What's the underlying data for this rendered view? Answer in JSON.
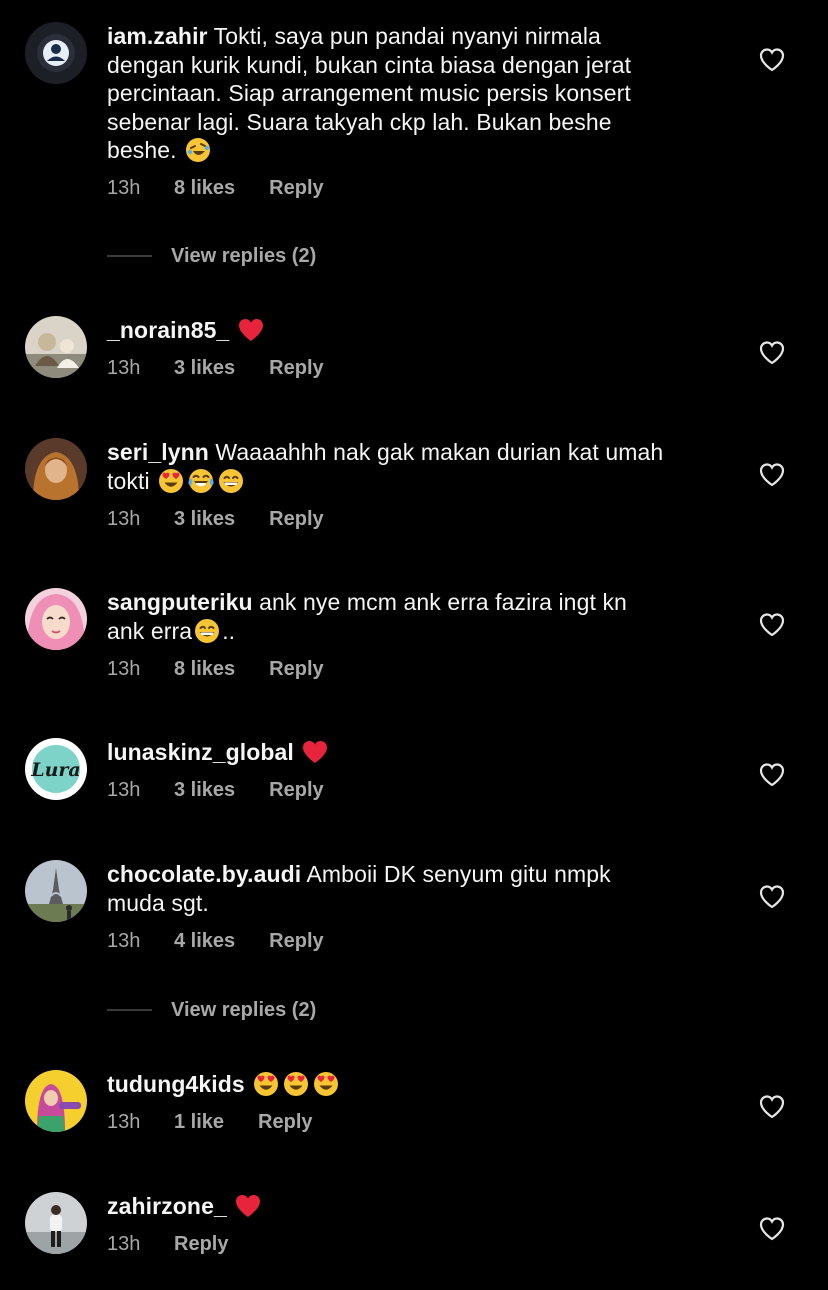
{
  "comments": [
    {
      "username": "iam.zahir",
      "text": " Tokti, saya pun pandai nyanyi nirmala\ndengan kurik kundi, bukan cinta biasa dengan jerat\npercintaan. Siap arrangement music persis konsert\nsebenar lagi. Suara takyah ckp lah. Bukan beshe\nbeshe. ",
      "emojis": [
        "rolling-on-floor-laughing"
      ],
      "time": "13h",
      "likes": "8 likes",
      "reply": "Reply",
      "view_replies": "View replies (2)"
    },
    {
      "username": "_norain85_",
      "text": " ",
      "emojis": [
        "red-heart"
      ],
      "time": "13h",
      "likes": "3 likes",
      "reply": "Reply"
    },
    {
      "username": "seri_lynn",
      "text": " Waaaahhh nak gak makan durian kat umah\ntokti ",
      "emojis": [
        "heart-eyes",
        "tears-of-joy",
        "grinning"
      ],
      "time": "13h",
      "likes": "3 likes",
      "reply": "Reply"
    },
    {
      "username": "sangputeriku",
      "text": " ank nye mcm ank erra fazira ingt kn\nank erra",
      "emojis": [
        "grinning"
      ],
      "text_after": "..",
      "time": "13h",
      "likes": "8 likes",
      "reply": "Reply"
    },
    {
      "username": "lunaskinz_global",
      "avatar_text": "Lura",
      "text": " ",
      "emojis": [
        "red-heart"
      ],
      "time": "13h",
      "likes": "3 likes",
      "reply": "Reply"
    },
    {
      "username": "chocolate.by.audi",
      "text": " Amboii DK senyum gitu nmpk\nmuda sgt.",
      "emojis": [],
      "time": "13h",
      "likes": "4 likes",
      "reply": "Reply",
      "view_replies": "View replies (2)"
    },
    {
      "username": "tudung4kids",
      "text": " ",
      "emojis": [
        "heart-eyes",
        "heart-eyes",
        "heart-eyes"
      ],
      "time": "13h",
      "likes": "1 like",
      "reply": "Reply"
    },
    {
      "username": "zahirzone_",
      "text": " ",
      "emojis": [
        "red-heart"
      ],
      "time": "13h",
      "likes": "",
      "reply": "Reply"
    }
  ],
  "colors": {
    "background": "#000000",
    "text": "#f5f5f5",
    "meta": "#a8a8a8"
  }
}
